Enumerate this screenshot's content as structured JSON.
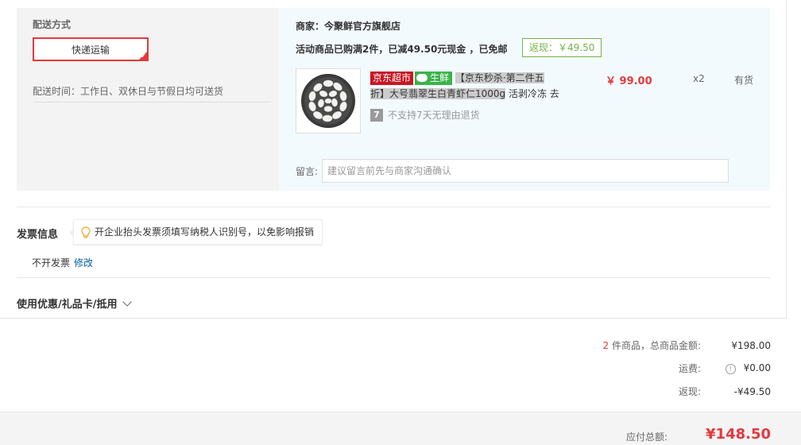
{
  "shipping": {
    "title": "配送方式",
    "method": "快递运输",
    "time": "配送时间：工作日、双休日与节假日均可送货"
  },
  "merchant": {
    "label": "商家：今聚鲜官方旗舰店",
    "promo": "活动商品已购满2件，已减49.50元现金 ，已免邮",
    "cashback_badge": "返现：￥49.50"
  },
  "item": {
    "tag_jd": "京东超市",
    "tag_fresh": "生鲜",
    "name_line1": "【京东秒杀·第二件五",
    "name_line2": "折】大号翡翠生白青虾仁1000g",
    "name_tail": " 活剥冷冻 去",
    "no_return_icon": "7",
    "no_return": "不支持7天无理由退货",
    "price": "￥ 99.00",
    "qty": "x2",
    "stock": "有货",
    "image_icon": "shrimp-image"
  },
  "remark": {
    "label": "留言:",
    "placeholder": "建议留言前先与商家沟通确认"
  },
  "invoice": {
    "title": "发票信息",
    "tip": "开企业抬头发票须填写纳税人识别号，以免影响报销",
    "value": "不开发票",
    "edit": "修改"
  },
  "coupon": {
    "label": "使用优惠/礼品卡/抵用"
  },
  "summary": {
    "count": "2",
    "count_label": " 件商品，总商品金额:",
    "goods_total": "¥198.00",
    "shipping_label": "运费:",
    "shipping_val": "¥0.00",
    "cashback_label": "返现:",
    "cashback_val": "-¥49.50",
    "payable_label": "应付总额:",
    "payable_val": "¥148.50"
  },
  "colors": {
    "accent": "#e4393c",
    "link": "#005ea7",
    "green": "#71b247"
  }
}
